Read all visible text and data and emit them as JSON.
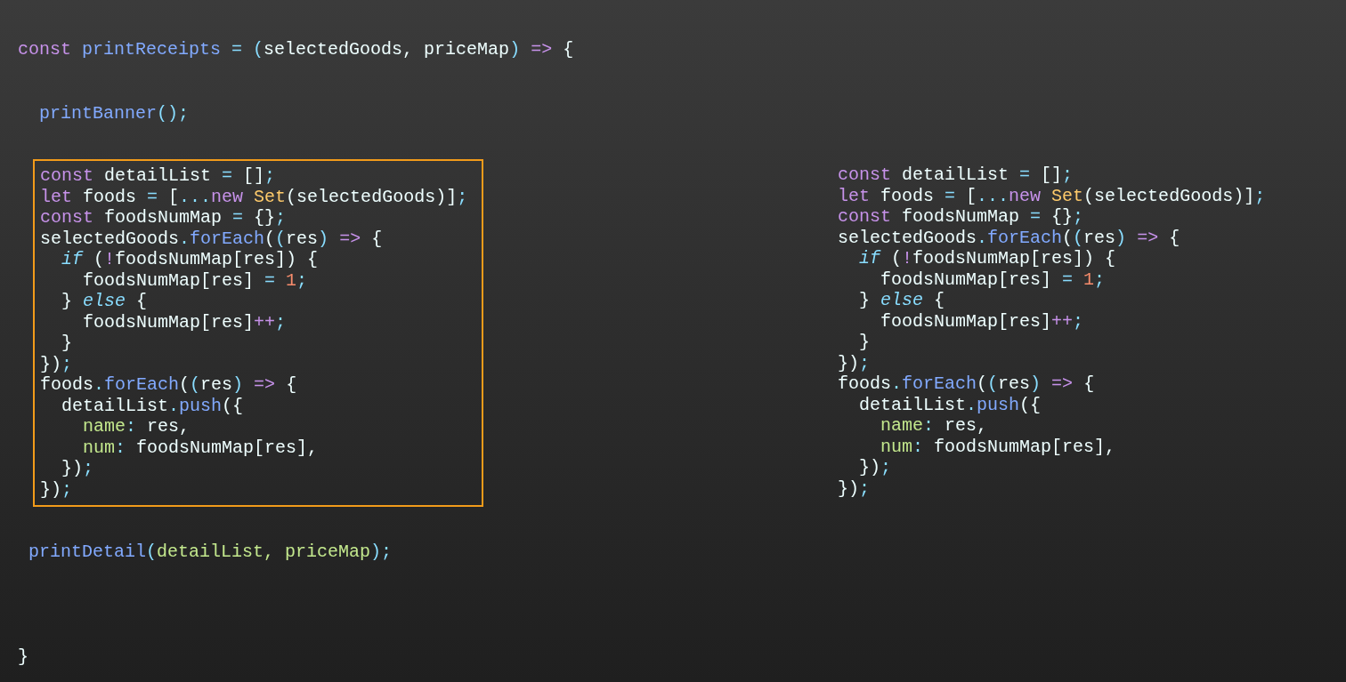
{
  "function_header": [
    {
      "text": "const",
      "kind": "keyword"
    },
    {
      "text": " printReceipts",
      "kind": "function"
    },
    {
      "text": " =",
      "kind": "operator"
    },
    {
      "text": " (",
      "kind": "operator"
    },
    {
      "text": "selectedGoods, priceMap",
      "kind": "plain"
    },
    {
      "text": ")",
      "kind": "operator"
    },
    {
      "text": " =>",
      "kind": "keyword"
    },
    {
      "text": " {",
      "kind": "plain"
    }
  ],
  "banner_call": [
    {
      "text": "printBanner",
      "kind": "function"
    },
    {
      "text": "();",
      "kind": "operator"
    }
  ],
  "highlighted_block": {
    "lines": [
      [
        {
          "text": "const",
          "kind": "keyword"
        },
        {
          "text": " detailList ",
          "kind": "plain"
        },
        {
          "text": "=",
          "kind": "operator"
        },
        {
          "text": " []",
          "kind": "plain"
        },
        {
          "text": ";",
          "kind": "operator"
        }
      ],
      [
        {
          "text": "let",
          "kind": "keyword"
        },
        {
          "text": " foods ",
          "kind": "plain"
        },
        {
          "text": "=",
          "kind": "operator"
        },
        {
          "text": " [",
          "kind": "plain"
        },
        {
          "text": "...",
          "kind": "operator"
        },
        {
          "text": "new",
          "kind": "keyword"
        },
        {
          "text": " Set",
          "kind": "class"
        },
        {
          "text": "(selectedGoods)]",
          "kind": "plain"
        },
        {
          "text": ";",
          "kind": "operator"
        }
      ],
      [
        {
          "text": "const",
          "kind": "keyword"
        },
        {
          "text": " foodsNumMap ",
          "kind": "plain"
        },
        {
          "text": "=",
          "kind": "operator"
        },
        {
          "text": " {}",
          "kind": "plain"
        },
        {
          "text": ";",
          "kind": "operator"
        }
      ],
      [
        {
          "text": "selectedGoods",
          "kind": "plain"
        },
        {
          "text": ".",
          "kind": "operator"
        },
        {
          "text": "forEach",
          "kind": "function"
        },
        {
          "text": "(",
          "kind": "plain"
        },
        {
          "text": "(",
          "kind": "operator"
        },
        {
          "text": "res",
          "kind": "plain"
        },
        {
          "text": ")",
          "kind": "operator"
        },
        {
          "text": " =>",
          "kind": "keyword"
        },
        {
          "text": " {",
          "kind": "plain"
        }
      ],
      [
        {
          "text": "  if",
          "kind": "control"
        },
        {
          "text": " (",
          "kind": "plain"
        },
        {
          "text": "!",
          "kind": "keyword"
        },
        {
          "text": "foodsNumMap[res]) {",
          "kind": "plain"
        }
      ],
      [
        {
          "text": "    foodsNumMap[res] ",
          "kind": "plain"
        },
        {
          "text": "=",
          "kind": "operator"
        },
        {
          "text": " 1",
          "kind": "number"
        },
        {
          "text": ";",
          "kind": "operator"
        }
      ],
      [
        {
          "text": "  } ",
          "kind": "plain"
        },
        {
          "text": "else",
          "kind": "control"
        },
        {
          "text": " {",
          "kind": "plain"
        }
      ],
      [
        {
          "text": "    foodsNumMap[res]",
          "kind": "plain"
        },
        {
          "text": "++",
          "kind": "keyword"
        },
        {
          "text": ";",
          "kind": "operator"
        }
      ],
      [
        {
          "text": "  }",
          "kind": "plain"
        }
      ],
      [
        {
          "text": "})",
          "kind": "plain"
        },
        {
          "text": ";",
          "kind": "operator"
        }
      ],
      [
        {
          "text": "foods",
          "kind": "plain"
        },
        {
          "text": ".",
          "kind": "operator"
        },
        {
          "text": "forEach",
          "kind": "function"
        },
        {
          "text": "(",
          "kind": "plain"
        },
        {
          "text": "(",
          "kind": "operator"
        },
        {
          "text": "res",
          "kind": "plain"
        },
        {
          "text": ")",
          "kind": "operator"
        },
        {
          "text": " =>",
          "kind": "keyword"
        },
        {
          "text": " {",
          "kind": "plain"
        }
      ],
      [
        {
          "text": "  detailList",
          "kind": "plain"
        },
        {
          "text": ".",
          "kind": "operator"
        },
        {
          "text": "push",
          "kind": "function"
        },
        {
          "text": "({",
          "kind": "plain"
        }
      ],
      [
        {
          "text": "    name",
          "kind": "property"
        },
        {
          "text": ":",
          "kind": "operator"
        },
        {
          "text": " res,",
          "kind": "plain"
        }
      ],
      [
        {
          "text": "    num",
          "kind": "property"
        },
        {
          "text": ":",
          "kind": "operator"
        },
        {
          "text": " foodsNumMap[res],",
          "kind": "plain"
        }
      ],
      [
        {
          "text": "  })",
          "kind": "plain"
        },
        {
          "text": ";",
          "kind": "operator"
        }
      ],
      [
        {
          "text": "})",
          "kind": "plain"
        },
        {
          "text": ";",
          "kind": "operator"
        }
      ]
    ]
  },
  "detail_call": [
    {
      "text": "printDetail",
      "kind": "function"
    },
    {
      "text": "(",
      "kind": "operator"
    },
    {
      "text": "detailList, priceMap",
      "kind": "property"
    },
    {
      "text": ");",
      "kind": "operator"
    }
  ],
  "closing": [
    {
      "text": "}",
      "kind": "plain"
    }
  ],
  "copy_block": {
    "lines": [
      [
        {
          "text": "const",
          "kind": "keyword"
        },
        {
          "text": " detailList ",
          "kind": "plain"
        },
        {
          "text": "=",
          "kind": "operator"
        },
        {
          "text": " []",
          "kind": "plain"
        },
        {
          "text": ";",
          "kind": "operator"
        }
      ],
      [
        {
          "text": "let",
          "kind": "keyword"
        },
        {
          "text": " foods ",
          "kind": "plain"
        },
        {
          "text": "=",
          "kind": "operator"
        },
        {
          "text": " [",
          "kind": "plain"
        },
        {
          "text": "...",
          "kind": "operator"
        },
        {
          "text": "new",
          "kind": "keyword"
        },
        {
          "text": " Set",
          "kind": "class"
        },
        {
          "text": "(selectedGoods)]",
          "kind": "plain"
        },
        {
          "text": ";",
          "kind": "operator"
        }
      ],
      [
        {
          "text": "const",
          "kind": "keyword"
        },
        {
          "text": " foodsNumMap ",
          "kind": "plain"
        },
        {
          "text": "=",
          "kind": "operator"
        },
        {
          "text": " {}",
          "kind": "plain"
        },
        {
          "text": ";",
          "kind": "operator"
        }
      ],
      [
        {
          "text": "selectedGoods",
          "kind": "plain"
        },
        {
          "text": ".",
          "kind": "operator"
        },
        {
          "text": "forEach",
          "kind": "function"
        },
        {
          "text": "(",
          "kind": "plain"
        },
        {
          "text": "(",
          "kind": "operator"
        },
        {
          "text": "res",
          "kind": "plain"
        },
        {
          "text": ")",
          "kind": "operator"
        },
        {
          "text": " =>",
          "kind": "keyword"
        },
        {
          "text": " {",
          "kind": "plain"
        }
      ],
      [
        {
          "text": "  if",
          "kind": "control"
        },
        {
          "text": " (",
          "kind": "plain"
        },
        {
          "text": "!",
          "kind": "keyword"
        },
        {
          "text": "foodsNumMap[res]) {",
          "kind": "plain"
        }
      ],
      [
        {
          "text": "    foodsNumMap[res] ",
          "kind": "plain"
        },
        {
          "text": "=",
          "kind": "operator"
        },
        {
          "text": " 1",
          "kind": "number"
        },
        {
          "text": ";",
          "kind": "operator"
        }
      ],
      [
        {
          "text": "  } ",
          "kind": "plain"
        },
        {
          "text": "else",
          "kind": "control"
        },
        {
          "text": " {",
          "kind": "plain"
        }
      ],
      [
        {
          "text": "    foodsNumMap[res]",
          "kind": "plain"
        },
        {
          "text": "++",
          "kind": "keyword"
        },
        {
          "text": ";",
          "kind": "operator"
        }
      ],
      [
        {
          "text": "  }",
          "kind": "plain"
        }
      ],
      [
        {
          "text": "})",
          "kind": "plain"
        },
        {
          "text": ";",
          "kind": "operator"
        }
      ],
      [
        {
          "text": "foods",
          "kind": "plain"
        },
        {
          "text": ".",
          "kind": "operator"
        },
        {
          "text": "forEach",
          "kind": "function"
        },
        {
          "text": "(",
          "kind": "plain"
        },
        {
          "text": "(",
          "kind": "operator"
        },
        {
          "text": "res",
          "kind": "plain"
        },
        {
          "text": ")",
          "kind": "operator"
        },
        {
          "text": " =>",
          "kind": "keyword"
        },
        {
          "text": " {",
          "kind": "plain"
        }
      ],
      [
        {
          "text": "  detailList",
          "kind": "plain"
        },
        {
          "text": ".",
          "kind": "operator"
        },
        {
          "text": "push",
          "kind": "function"
        },
        {
          "text": "({",
          "kind": "plain"
        }
      ],
      [
        {
          "text": "    name",
          "kind": "property"
        },
        {
          "text": ":",
          "kind": "operator"
        },
        {
          "text": " res,",
          "kind": "plain"
        }
      ],
      [
        {
          "text": "    num",
          "kind": "property"
        },
        {
          "text": ":",
          "kind": "operator"
        },
        {
          "text": " foodsNumMap[res],",
          "kind": "plain"
        }
      ],
      [
        {
          "text": "  })",
          "kind": "plain"
        },
        {
          "text": ";",
          "kind": "operator"
        }
      ],
      [
        {
          "text": "})",
          "kind": "plain"
        },
        {
          "text": ";",
          "kind": "operator"
        }
      ]
    ]
  }
}
